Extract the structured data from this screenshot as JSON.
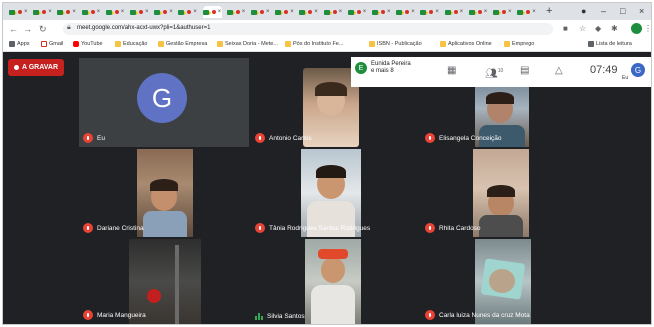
{
  "browser": {
    "tabs_count": 22,
    "active_tab_index": 8,
    "new_tab_label": "+",
    "tab_close": "×",
    "url": "meet.google.com/ahx-acxt-uwx?pli=1&authuser=1",
    "window_controls": [
      "–",
      "□",
      "×"
    ]
  },
  "bookmarks": [
    {
      "label": "Apps",
      "icon": "apps-icon"
    },
    {
      "label": "Gmail",
      "icon": "gmail-icon"
    },
    {
      "label": "YouTube",
      "icon": "youtube-icon"
    },
    {
      "label": "Educação",
      "icon": "folder-icon"
    },
    {
      "label": "Gestão Empresa",
      "icon": "folder-icon"
    },
    {
      "label": "Seixas Doria - Mete...",
      "icon": "folder-icon"
    },
    {
      "label": "Pós do Instituto Fe...",
      "icon": "folder-icon"
    },
    {
      "label": "ISBN - Publicação",
      "icon": "folder-icon"
    },
    {
      "label": "Aplicativos Online",
      "icon": "folder-icon"
    },
    {
      "label": "Emprego",
      "icon": "folder-icon"
    }
  ],
  "reading_list": "Lista de leitura",
  "meet": {
    "record_label": "A GRAVAR",
    "presenter_name": "Eunida Pereira",
    "presenter_more": "e mais 8",
    "presenter_initial": "E",
    "participants_count": "10",
    "time": "07:49",
    "me_label": "Eu",
    "me_initial": "G",
    "tiles": [
      {
        "name": "Eu",
        "avatar": "G",
        "muted": true
      },
      {
        "name": "Antonio Carlos",
        "muted": true
      },
      {
        "name": "Elisangela Conceição",
        "muted": true
      },
      {
        "name": "Dariane Cristina",
        "muted": true
      },
      {
        "name": "Tânia Rodrigues Santos Rodrigues",
        "muted": true
      },
      {
        "name": "Rhita Cardoso",
        "muted": true
      },
      {
        "name": "Maria Mangueira",
        "muted": true
      },
      {
        "name": "Silvia Santos",
        "muted": false
      },
      {
        "name": "Carla luiza Nunes da cruz Mota",
        "muted": true
      }
    ]
  },
  "colors": {
    "meet_bg": "#202124",
    "tile_bg": "#3c4043",
    "record_red": "#c5221f",
    "mic_off": "#ea4335",
    "avatar_blue": "#5f72c4",
    "speaking_green": "#34a853"
  }
}
